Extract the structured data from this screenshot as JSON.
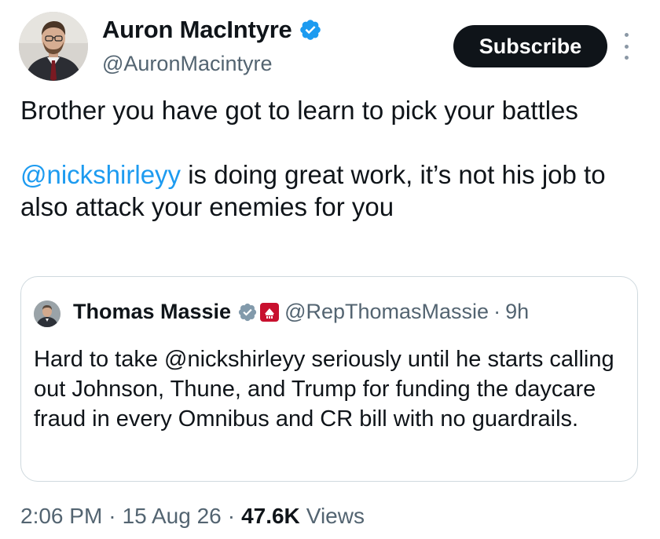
{
  "author": {
    "name": "Auron MacIntyre",
    "handle": "@AuronMacintyre",
    "verified_color": "#1d9bf0"
  },
  "actions": {
    "subscribe_label": "Subscribe",
    "more_icon": "more-vertical-icon"
  },
  "tweet": {
    "line1": "Brother you have got to learn to pick your battles",
    "mention": "@nickshirleyy",
    "line2_rest": " is doing great work, it’s not his job to also attack your enemies for you"
  },
  "quote": {
    "name": "Thomas Massie",
    "handle": "@RepThomasMassie",
    "separator": "·",
    "time": "9h",
    "text": "Hard to take @nickshirleyy seriously until he starts calling out Johnson, Thune, and Trump for funding the daycare fraud in every Omnibus and CR bill with no guardrails.",
    "badge_color": "#829aab",
    "seal_color": "#c8102e"
  },
  "meta": {
    "time": "2:06 PM",
    "date": "15 Aug 26",
    "separator": "·",
    "views_count": "47.6K",
    "views_label": "Views"
  }
}
